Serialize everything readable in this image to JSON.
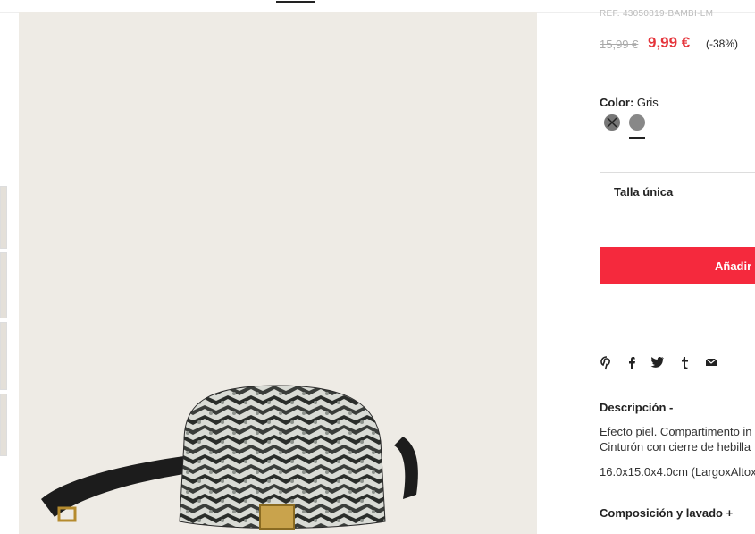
{
  "product": {
    "ref": "REF. 43050819-BAMBI-LM",
    "price_old": "15,99 €",
    "price_new": "9,99 €",
    "discount": "(-38%)"
  },
  "color": {
    "label": "Color:",
    "value": "Gris"
  },
  "size": {
    "selected": "Talla única"
  },
  "cart": {
    "add_label": "Añadir"
  },
  "share": {
    "icons": [
      "pinterest-icon",
      "facebook-icon",
      "twitter-icon",
      "tumblr-icon",
      "mail-icon"
    ],
    "glyphs": [
      "P",
      "f",
      "",
      "t",
      "✉"
    ]
  },
  "description": {
    "title": "Descripción  -",
    "lines": [
      "Efecto piel. Compartimento in",
      "Cinturón con cierre de hebilla",
      "16.0x15.0x4.0cm (LargoxAltox"
    ]
  },
  "composition": {
    "title": "Composición y lavado  +"
  },
  "colors": {
    "accent": "#f5293d",
    "price_sale": "#e5343b",
    "photo_bg": "#eeebe5"
  }
}
